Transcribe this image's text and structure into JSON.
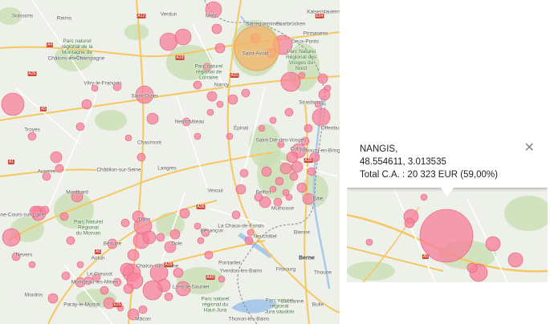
{
  "colors": {
    "land": "#eef0ea",
    "forest": "#c9dfb4",
    "water": "#a9c9ea",
    "road_major": "#f6c760",
    "road_minor": "#ffffff",
    "border": "#8a8a8a",
    "marker_fill": "#f7809b",
    "marker_stroke": "#e8587a",
    "marker_highlight": "#f5b36a"
  },
  "icons": [
    "close-icon",
    "map-marker-circle"
  ],
  "left_map": {
    "place_labels": [
      {
        "name": "Soissons",
        "type": "town"
      },
      {
        "name": "Reims",
        "type": "town"
      },
      {
        "name": "Parc naturel\nrégional de la\nMontagne de\nReims",
        "type": "park"
      },
      {
        "name": "Châlons-en-Champagne",
        "type": "town"
      },
      {
        "name": "Vitry-le-François",
        "type": "town"
      },
      {
        "name": "Verdun",
        "type": "town"
      },
      {
        "name": "Metz",
        "type": "town"
      },
      {
        "name": "Saint-Avold",
        "type": "town"
      },
      {
        "name": "Saarbrücken",
        "type": "town"
      },
      {
        "name": "Kaiserslautern",
        "type": "town"
      },
      {
        "name": "Sarreguemines",
        "type": "town"
      },
      {
        "name": "Deux-Ponts",
        "type": "town"
      },
      {
        "name": "Pirmasens",
        "type": "town"
      },
      {
        "name": "Parc naturel\nrégional de\nLorraine",
        "type": "park"
      },
      {
        "name": "Parc Naturel\nRégional des\nVosges du\nNord",
        "type": "park"
      },
      {
        "name": "Nancy",
        "type": "town"
      },
      {
        "name": "Saint-Dizier",
        "type": "town"
      },
      {
        "name": "Strasbourg",
        "type": "town"
      },
      {
        "name": "Offenburg",
        "type": "town"
      },
      {
        "name": "Troyes",
        "type": "town"
      },
      {
        "name": "Neufchâteau",
        "type": "town"
      },
      {
        "name": "Saint-Dié-des-Vosges",
        "type": "town"
      },
      {
        "name": "Épinal",
        "type": "town"
      },
      {
        "name": "Chaumont",
        "type": "town"
      },
      {
        "name": "Colmar",
        "type": "town"
      },
      {
        "name": "Fribourg-en-Brisgau",
        "type": "town"
      },
      {
        "name": "Auxerre",
        "type": "town"
      },
      {
        "name": "Châtillon-sur-Seine",
        "type": "town"
      },
      {
        "name": "Langres",
        "type": "town"
      },
      {
        "name": "Vesoul",
        "type": "town"
      },
      {
        "name": "Belfort",
        "type": "town"
      },
      {
        "name": "Mulhouse",
        "type": "town"
      },
      {
        "name": "Bâle",
        "type": "town"
      },
      {
        "name": "Montbard",
        "type": "town"
      },
      {
        "name": "Cosne-Cours-sur-Loire",
        "type": "town"
      },
      {
        "name": "Parc Naturel\nRégional\ndu Morvan",
        "type": "park"
      },
      {
        "name": "Dijon",
        "type": "town"
      },
      {
        "name": "Dole",
        "type": "town"
      },
      {
        "name": "Besançon",
        "type": "town"
      },
      {
        "name": "Beaune",
        "type": "town"
      },
      {
        "name": "Nevers",
        "type": "town"
      },
      {
        "name": "Autun",
        "type": "town"
      },
      {
        "name": "Le Creusot",
        "type": "town"
      },
      {
        "name": "Chalon-sur-Saône",
        "type": "town"
      },
      {
        "name": "Montceau-les-Mines",
        "type": "town"
      },
      {
        "name": "Lons-le-Saunier",
        "type": "town"
      },
      {
        "name": "Pontarlier",
        "type": "town"
      },
      {
        "name": "La Chaux-de-Fonds",
        "type": "town"
      },
      {
        "name": "Neuchâtel",
        "type": "town"
      },
      {
        "name": "Bienne",
        "type": "town"
      },
      {
        "name": "Berne",
        "type": "city"
      },
      {
        "name": "Yverdon-les-Bains",
        "type": "town"
      },
      {
        "name": "Fribourg",
        "type": "town"
      },
      {
        "name": "Thoune",
        "type": "town"
      },
      {
        "name": "Lausanne",
        "type": "town"
      },
      {
        "name": "Moulins",
        "type": "town"
      },
      {
        "name": "Paray-le-Monial",
        "type": "town"
      },
      {
        "name": "Mâcon",
        "type": "town"
      },
      {
        "name": "Parc naturel\nrégional du\nHaut-Jura",
        "type": "park"
      },
      {
        "name": "Parc naturel\nrégional\nJura vaudois",
        "type": "park"
      },
      {
        "name": "Thonon-les-Bains",
        "type": "town"
      },
      {
        "name": "Bulle",
        "type": "town"
      }
    ],
    "road_badges": [
      "A4",
      "A26",
      "A31",
      "A5",
      "A6",
      "A36",
      "A39",
      "A40",
      "A35",
      "A1",
      "A12",
      "A19",
      "E25",
      "E54"
    ]
  },
  "info_window": {
    "title": "NANGIS,",
    "coordinates": "48.554611, 3.013535",
    "total_label": "Total C.A. : 20 323 EUR (59,00%)"
  },
  "right_map": {
    "road_badges": [
      "A5"
    ]
  }
}
